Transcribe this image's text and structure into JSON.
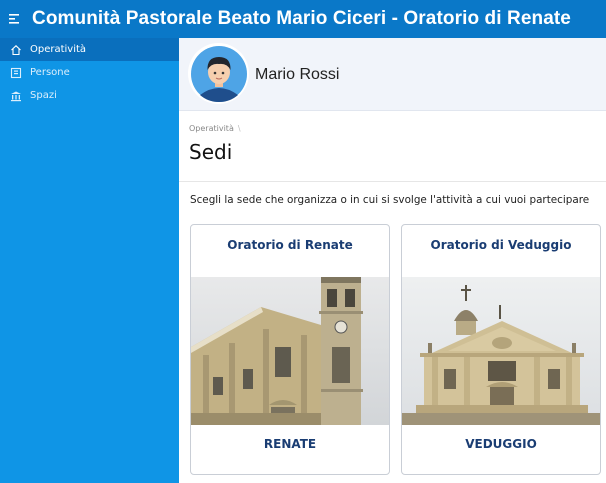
{
  "app": {
    "title": "Comunità Pastorale Beato Mario Ciceri - Oratorio di Renate",
    "menu_icon": "menu-icon"
  },
  "sidebar": {
    "items": [
      {
        "label": "Operatività",
        "icon": "home-icon",
        "active": true
      },
      {
        "label": "Persone",
        "icon": "person-card-icon",
        "active": false
      },
      {
        "label": "Spazi",
        "icon": "building-icon",
        "active": false
      }
    ]
  },
  "user": {
    "name": "Mario Rossi",
    "avatar_icon": "user-avatar-icon"
  },
  "breadcrumb": {
    "items": [
      "Operatività"
    ],
    "separator": "\\"
  },
  "page": {
    "title": "Sedi",
    "subtitle": "Scegli la sede che organizza o in cui si svolge l'attività a cui vuoi partecipare"
  },
  "sedi": [
    {
      "title": "Oratorio di Renate",
      "button": "RENATE",
      "image": "church-photo-renate"
    },
    {
      "title": "Oratorio di Veduggio",
      "button": "VEDUGGIO",
      "image": "church-photo-veduggio"
    }
  ],
  "colors": {
    "topbar": "#0a78c8",
    "sidebar": "#0f95e6",
    "sidebar_active": "#0a6fbd",
    "header_bg": "#f1f4fa",
    "card_text": "#1a3d73"
  }
}
